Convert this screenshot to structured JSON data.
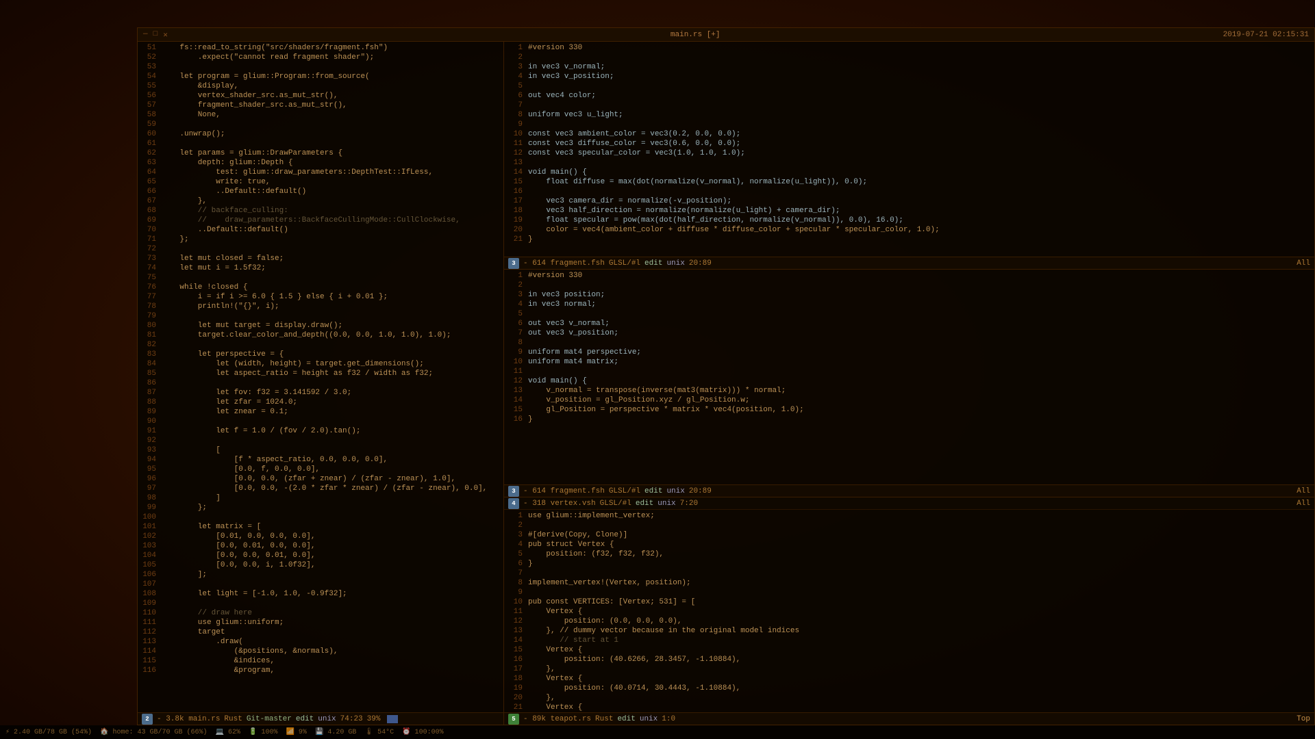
{
  "window": {
    "title": "main.rs [+]",
    "datetime": "2019-07-21 02:15:31"
  },
  "left_pane": {
    "status": {
      "pane_num": "2",
      "indicator_color": "blue",
      "file_info": "- 3.8k main.rs",
      "lang": "Rust",
      "git": "Git-master",
      "mode": "edit",
      "encoding": "unix",
      "position": "74:23",
      "percent": "39%"
    },
    "lines": [
      {
        "num": "51",
        "content": "    fs::read_to_string(\"src/shaders/fragment.fsh\")"
      },
      {
        "num": "52",
        "content": "        .expect(\"cannot read fragment shader\");"
      },
      {
        "num": "53",
        "content": ""
      },
      {
        "num": "54",
        "content": "    let program = glium::Program::from_source("
      },
      {
        "num": "55",
        "content": "        &display,"
      },
      {
        "num": "56",
        "content": "        vertex_shader_src.as_mut_str(),"
      },
      {
        "num": "57",
        "content": "        fragment_shader_src.as_mut_str(),"
      },
      {
        "num": "58",
        "content": "        None,"
      },
      {
        "num": "59",
        "content": ""
      },
      {
        "num": "60",
        "content": "    .unwrap();"
      },
      {
        "num": "61",
        "content": ""
      },
      {
        "num": "62",
        "content": "    let params = glium::DrawParameters {"
      },
      {
        "num": "63",
        "content": "        depth: glium::Depth {"
      },
      {
        "num": "64",
        "content": "            test: glium::draw_parameters::DepthTest::IfLess,"
      },
      {
        "num": "65",
        "content": "            write: true,"
      },
      {
        "num": "66",
        "content": "            ..Default::default()"
      },
      {
        "num": "67",
        "content": "        },"
      },
      {
        "num": "68",
        "content": "        // backface_culling:"
      },
      {
        "num": "69",
        "content": "        //    draw_parameters::BackfaceCullingMode::CullClockwise,"
      },
      {
        "num": "70",
        "content": "        ..Default::default()"
      },
      {
        "num": "71",
        "content": "    };"
      },
      {
        "num": "72",
        "content": ""
      },
      {
        "num": "73",
        "content": "    let mut closed = false;"
      },
      {
        "num": "74",
        "content": "    let mut i = 1.5f32;"
      },
      {
        "num": "75",
        "content": ""
      },
      {
        "num": "76",
        "content": "    while !closed {"
      },
      {
        "num": "77",
        "content": "        i = if i >= 6.0 { 1.5 } else { i + 0.01 };"
      },
      {
        "num": "78",
        "content": "        println!(\"{}\", i);"
      },
      {
        "num": "79",
        "content": ""
      },
      {
        "num": "80",
        "content": "        let mut target = display.draw();"
      },
      {
        "num": "81",
        "content": "        target.clear_color_and_depth((0.0, 0.0, 1.0, 1.0), 1.0);"
      },
      {
        "num": "82",
        "content": ""
      },
      {
        "num": "83",
        "content": "        let perspective = {"
      },
      {
        "num": "84",
        "content": "            let (width, height) = target.get_dimensions();"
      },
      {
        "num": "85",
        "content": "            let aspect_ratio = height as f32 / width as f32;"
      },
      {
        "num": "86",
        "content": ""
      },
      {
        "num": "87",
        "content": "            let fov: f32 = 3.141592 / 3.0;"
      },
      {
        "num": "88",
        "content": "            let zfar = 1024.0;"
      },
      {
        "num": "89",
        "content": "            let znear = 0.1;"
      },
      {
        "num": "90",
        "content": ""
      },
      {
        "num": "91",
        "content": "            let f = 1.0 / (fov / 2.0).tan();"
      },
      {
        "num": "92",
        "content": ""
      },
      {
        "num": "93",
        "content": "            ["
      },
      {
        "num": "94",
        "content": "                [f * aspect_ratio, 0.0, 0.0, 0.0],"
      },
      {
        "num": "95",
        "content": "                [0.0, f, 0.0, 0.0],"
      },
      {
        "num": "96",
        "content": "                [0.0, 0.0, (zfar + znear) / (zfar - znear), 1.0],"
      },
      {
        "num": "97",
        "content": "                [0.0, 0.0, -(2.0 * zfar * znear) / (zfar - znear), 0.0],"
      },
      {
        "num": "98",
        "content": "            ]"
      },
      {
        "num": "99",
        "content": "        };"
      },
      {
        "num": "100",
        "content": ""
      },
      {
        "num": "101",
        "content": "        let matrix = ["
      },
      {
        "num": "102",
        "content": "            [0.01, 0.0, 0.0, 0.0],"
      },
      {
        "num": "103",
        "content": "            [0.0, 0.01, 0.0, 0.0],"
      },
      {
        "num": "104",
        "content": "            [0.0, 0.0, 0.01, 0.0],"
      },
      {
        "num": "105",
        "content": "            [0.0, 0.0, i, 1.0f32],"
      },
      {
        "num": "106",
        "content": "        ];"
      },
      {
        "num": "107",
        "content": ""
      },
      {
        "num": "108",
        "content": "        let light = [-1.0, 1.0, -0.9f32];"
      },
      {
        "num": "109",
        "content": ""
      },
      {
        "num": "110",
        "content": "        // draw here"
      },
      {
        "num": "111",
        "content": "        use glium::uniform;"
      },
      {
        "num": "112",
        "content": "        target"
      },
      {
        "num": "113",
        "content": "            .draw("
      },
      {
        "num": "114",
        "content": "                (&positions, &normals),"
      },
      {
        "num": "115",
        "content": "                &indices,"
      },
      {
        "num": "116",
        "content": "                &program,"
      }
    ]
  },
  "right_top": {
    "status": {
      "pane_num": "3",
      "file_info": "- 614 fragment.fsh",
      "lang": "GLSL/#l",
      "mode": "edit",
      "encoding": "unix",
      "position": "20:89",
      "all": "All"
    },
    "lines": [
      {
        "num": "1",
        "content": "#version 330"
      },
      {
        "num": "2",
        "content": ""
      },
      {
        "num": "3",
        "content": "in vec3 v_normal;"
      },
      {
        "num": "4",
        "content": "in vec3 v_position;"
      },
      {
        "num": "5",
        "content": ""
      },
      {
        "num": "6",
        "content": "out vec4 color;"
      },
      {
        "num": "7",
        "content": ""
      },
      {
        "num": "8",
        "content": "uniform vec3 u_light;"
      },
      {
        "num": "9",
        "content": ""
      },
      {
        "num": "10",
        "content": "const vec3 ambient_color = vec3(0.2, 0.0, 0.0);"
      },
      {
        "num": "11",
        "content": "const vec3 diffuse_color = vec3(0.6, 0.0, 0.0);"
      },
      {
        "num": "12",
        "content": "const vec3 specular_color = vec3(1.0, 1.0, 1.0);"
      },
      {
        "num": "13",
        "content": ""
      },
      {
        "num": "14",
        "content": "void main() {"
      },
      {
        "num": "15",
        "content": "    float diffuse = max(dot(normalize(v_normal), normalize(u_light)), 0.0);"
      },
      {
        "num": "16",
        "content": ""
      },
      {
        "num": "17",
        "content": "    vec3 camera_dir = normalize(-v_position);"
      },
      {
        "num": "18",
        "content": "    vec3 half_direction = normalize(normalize(u_light) + camera_dir);"
      },
      {
        "num": "19",
        "content": "    float specular = pow(max(dot(half_direction, normalize(v_normal)), 0.0), 16.0);"
      },
      {
        "num": "20",
        "content": "    color = vec4(ambient_color + diffuse * diffuse_color + specular * specular_color, 1.0);"
      },
      {
        "num": "21",
        "content": "}"
      }
    ]
  },
  "right_middle": {
    "status": {
      "pane_num": "3",
      "file_info": "- 614 fragment.fsh",
      "lang": "GLSL/#l",
      "mode": "edit",
      "encoding": "unix",
      "position": "20:89",
      "all": "All"
    },
    "lines": [
      {
        "num": "1",
        "content": "#version 330"
      },
      {
        "num": "2",
        "content": ""
      },
      {
        "num": "3",
        "content": "in vec3 position;"
      },
      {
        "num": "4",
        "content": "in vec3 normal;"
      },
      {
        "num": "5",
        "content": ""
      },
      {
        "num": "6",
        "content": "out vec3 v_normal;"
      },
      {
        "num": "7",
        "content": "out vec3 v_position;"
      },
      {
        "num": "8",
        "content": ""
      },
      {
        "num": "9",
        "content": "uniform mat4 perspective;"
      },
      {
        "num": "10",
        "content": "uniform mat4 matrix;"
      },
      {
        "num": "11",
        "content": ""
      },
      {
        "num": "12",
        "content": "void main() {"
      },
      {
        "num": "13",
        "content": "    v_normal = transpose(inverse(mat3(matrix))) * normal;"
      },
      {
        "num": "14",
        "content": "    v_position = gl_Position.xyz / gl_Position.w;"
      },
      {
        "num": "15",
        "content": "    gl_Position = perspective * matrix * vec4(position, 1.0);"
      },
      {
        "num": "16",
        "content": "}"
      }
    ]
  },
  "right_bottom": {
    "status": {
      "pane_num": "4",
      "file_info": "- 318 vertex.vsh",
      "lang": "GLSL/#l",
      "mode": "edit",
      "encoding": "unix",
      "position": "7:20",
      "all": "All"
    },
    "bottom_status": {
      "pane_num": "5",
      "file_info": "- 89k teapot.rs",
      "lang": "Rust",
      "mode": "edit",
      "encoding": "unix",
      "position": "1:0",
      "top": "Top"
    },
    "lines": [
      {
        "num": "1",
        "content": "use glium::implement_vertex;"
      },
      {
        "num": "2",
        "content": ""
      },
      {
        "num": "3",
        "content": "#[derive(Copy, Clone)]"
      },
      {
        "num": "4",
        "content": "pub struct Vertex {"
      },
      {
        "num": "5",
        "content": "    position: (f32, f32, f32),"
      },
      {
        "num": "6",
        "content": "}"
      },
      {
        "num": "7",
        "content": ""
      },
      {
        "num": "8",
        "content": "implement_vertex!(Vertex, position);"
      },
      {
        "num": "9",
        "content": ""
      },
      {
        "num": "10",
        "content": "pub const VERTICES: [Vertex; 531] = ["
      },
      {
        "num": "11",
        "content": "    Vertex {"
      },
      {
        "num": "12",
        "content": "        position: (0.0, 0.0, 0.0),"
      },
      {
        "num": "13",
        "content": "    }, // dummy vector because in the original model indices"
      },
      {
        "num": "14",
        "content": "       // start at 1"
      },
      {
        "num": "15",
        "content": "    Vertex {"
      },
      {
        "num": "16",
        "content": "        position: (40.6266, 28.3457, -1.10884),"
      },
      {
        "num": "17",
        "content": "    },"
      },
      {
        "num": "18",
        "content": "    Vertex {"
      },
      {
        "num": "19",
        "content": "        position: (40.0714, 30.4443, -1.10884),"
      },
      {
        "num": "20",
        "content": "    },"
      },
      {
        "num": "21",
        "content": "    Vertex {"
      }
    ]
  },
  "system_bar": {
    "items": [
      "2.40 GB/78 GB (54%)",
      "home: 43 GB/70 GB (66%)",
      "62%",
      "100%",
      "9%",
      "4.20 GB",
      "54°C",
      "100:00%"
    ]
  }
}
